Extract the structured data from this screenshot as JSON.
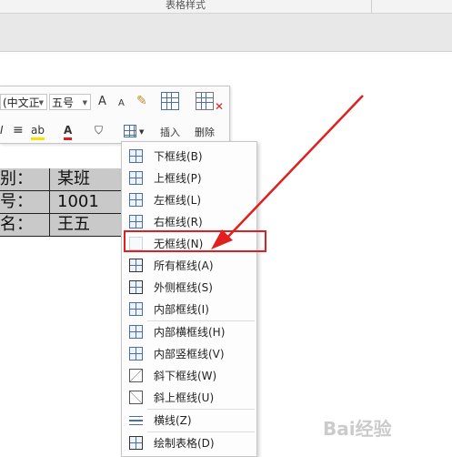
{
  "ribbon": {
    "group_label": "表格样式"
  },
  "mini_toolbar": {
    "font_name": "(中文正",
    "font_size": "五号",
    "grow_font": "A",
    "shrink_font": "A",
    "insert_label": "插入",
    "delete_label": "删除",
    "bold_glyph": "I",
    "align_glyph": "≡",
    "highlight_glyph": "ab",
    "font_color_glyph": "A"
  },
  "doc_table": {
    "rows": [
      {
        "label": "班别：",
        "value": "某班"
      },
      {
        "label": "学号：",
        "value": "1001"
      },
      {
        "label": "姓名：",
        "value": "王五"
      }
    ]
  },
  "border_menu": {
    "items": [
      {
        "label": "下框线(B)"
      },
      {
        "label": "上框线(P)"
      },
      {
        "label": "左框线(L)"
      },
      {
        "label": "右框线(R)"
      },
      {
        "label": "无框线(N)"
      },
      {
        "label": "所有框线(A)"
      },
      {
        "label": "外侧框线(S)"
      },
      {
        "label": "内部框线(I)"
      },
      {
        "label": "内部横框线(H)"
      },
      {
        "label": "内部竖框线(V)"
      },
      {
        "label": "斜下框线(W)"
      },
      {
        "label": "斜上框线(U)"
      },
      {
        "label": "横线(Z)"
      },
      {
        "label": "绘制表格(D)"
      }
    ]
  },
  "colors": {
    "highlight_box": "#e02020",
    "arrow": "#e02020",
    "icon_blue": "#4a6fa5"
  },
  "watermark": "Bai经验"
}
